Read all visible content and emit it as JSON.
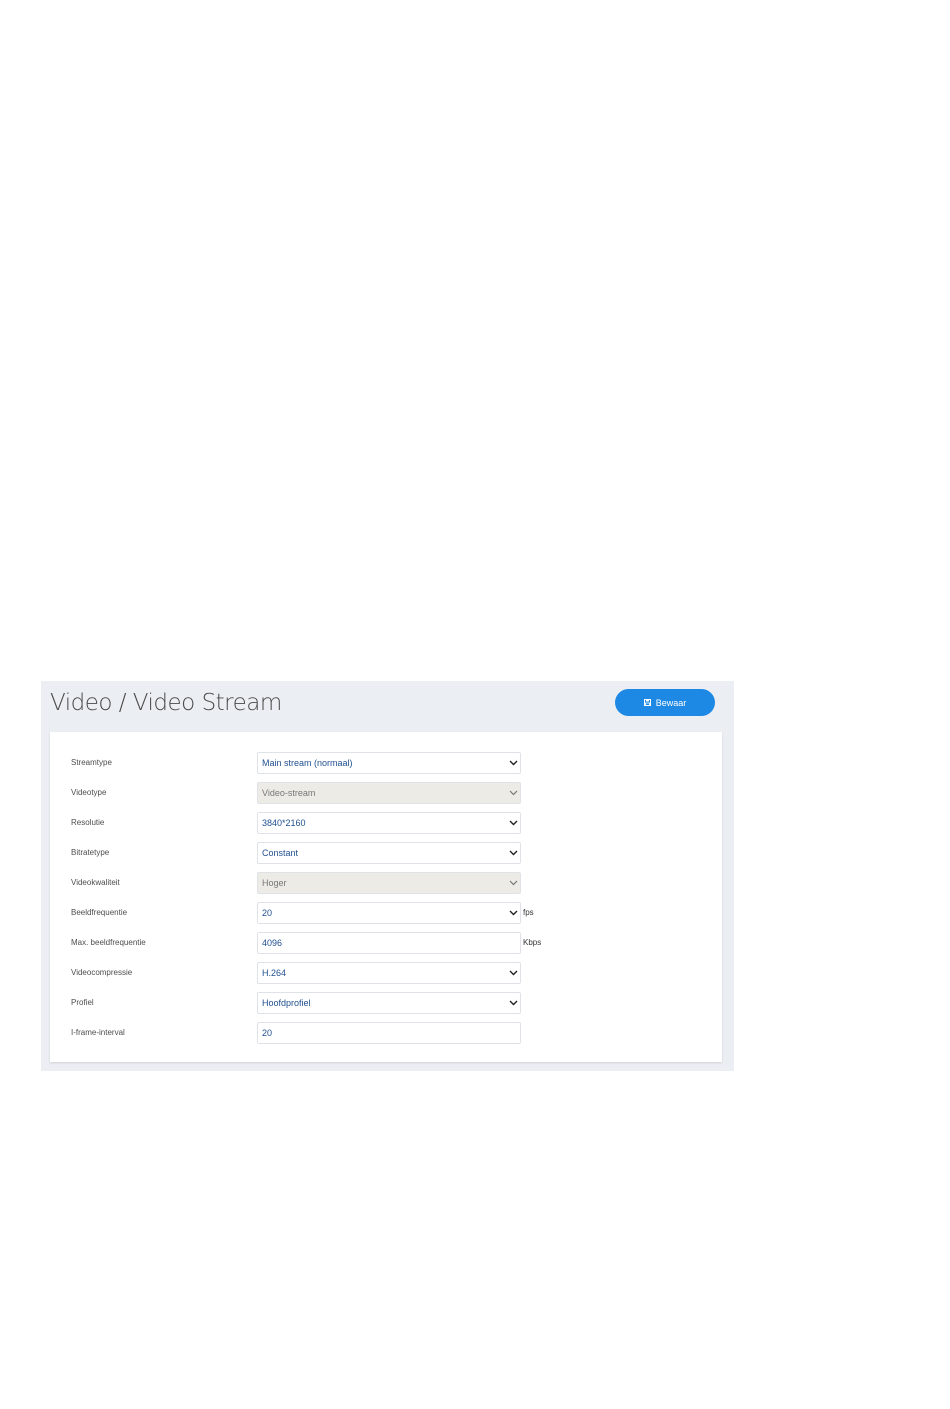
{
  "header": {
    "title": "Video / Video Stream",
    "save_label": "Bewaar",
    "save_icon": "floppy-disk-icon"
  },
  "colors": {
    "accent": "#1e88e5",
    "panel_bg": "#ebeef2",
    "field_text": "#1f4f8f",
    "disabled_bg": "#ecebe6"
  },
  "form": {
    "streamtype": {
      "label": "Streamtype",
      "value": "Main stream (normaal)"
    },
    "videotype": {
      "label": "Videotype",
      "value": "Video-stream"
    },
    "resolutie": {
      "label": "Resolutie",
      "value": "3840*2160"
    },
    "bitratetype": {
      "label": "Bitratetype",
      "value": "Constant"
    },
    "videokwaliteit": {
      "label": "Videokwaliteit",
      "value": "Hoger"
    },
    "beeldfrequentie": {
      "label": "Beeldfrequentie",
      "value": "20",
      "unit": "fps"
    },
    "max_beeldfrequentie": {
      "label": "Max. beeldfrequentie",
      "value": "4096",
      "unit": "Kbps"
    },
    "videocompressie": {
      "label": "Videocompressie",
      "value": "H.264"
    },
    "profiel": {
      "label": "Profiel",
      "value": "Hoofdprofiel"
    },
    "iframe_interval": {
      "label": "I-frame-interval",
      "value": "20"
    }
  }
}
